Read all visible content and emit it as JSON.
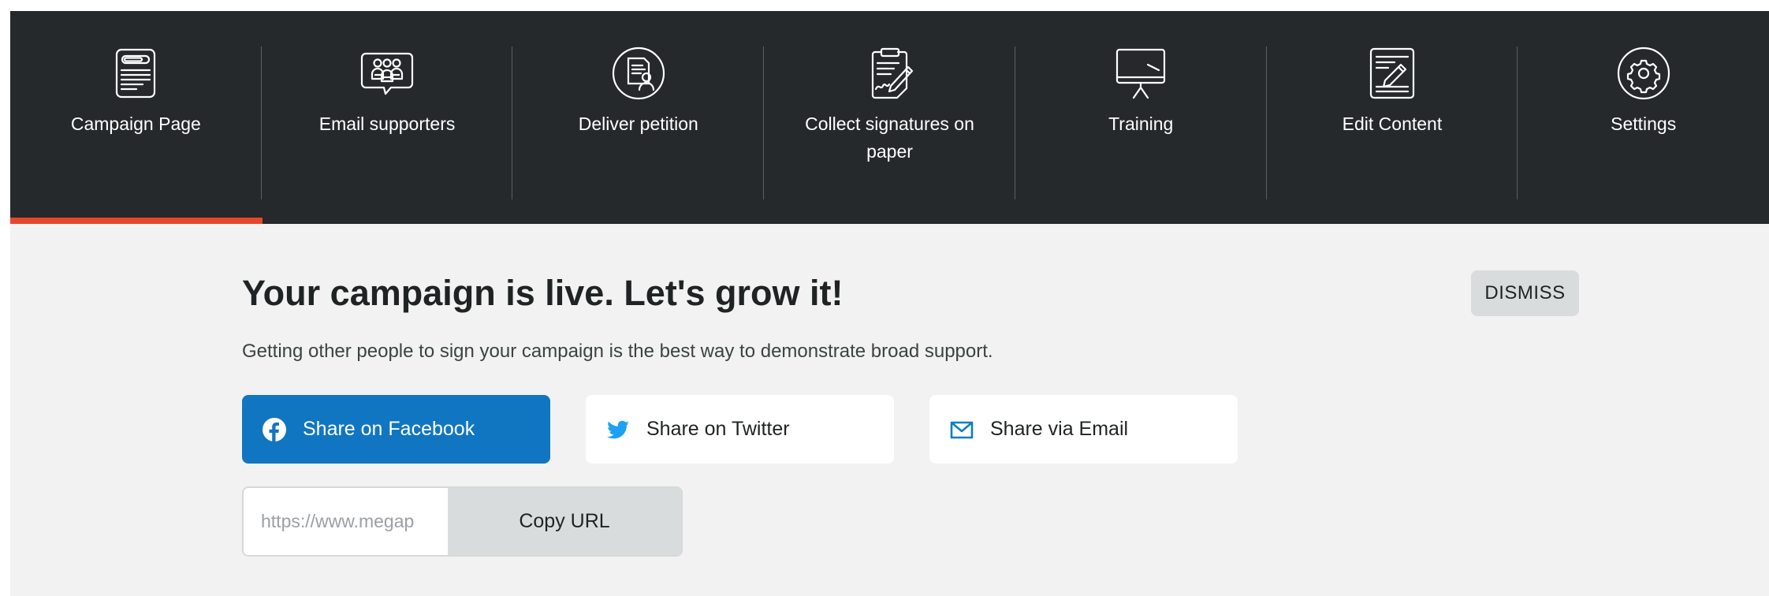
{
  "nav": {
    "items": [
      {
        "label": "Campaign Page",
        "icon": "campaign-page-icon"
      },
      {
        "label": "Email supporters",
        "icon": "email-supporters-icon"
      },
      {
        "label": "Deliver petition",
        "icon": "deliver-petition-icon"
      },
      {
        "label": "Collect signatures on paper",
        "icon": "clipboard-icon"
      },
      {
        "label": "Training",
        "icon": "training-icon"
      },
      {
        "label": "Edit Content",
        "icon": "edit-content-icon"
      },
      {
        "label": "Settings",
        "icon": "gear-icon"
      }
    ],
    "active_index": 0
  },
  "banner": {
    "headline": "Your campaign is live. Let's grow it!",
    "subtext": "Getting other people to sign your campaign is the best way to demonstrate broad support.",
    "dismiss_label": "DISMISS"
  },
  "share": {
    "facebook_label": "Share on Facebook",
    "twitter_label": "Share on Twitter",
    "email_label": "Share via Email"
  },
  "url": {
    "value": "https://www.megap",
    "copy_label": "Copy URL"
  },
  "colors": {
    "nav_bg": "#25292b",
    "active_underline": "#e4472a",
    "facebook_blue": "#1176c1",
    "twitter_blue": "#1da1f2",
    "email_teal": "#0e7fc0"
  }
}
